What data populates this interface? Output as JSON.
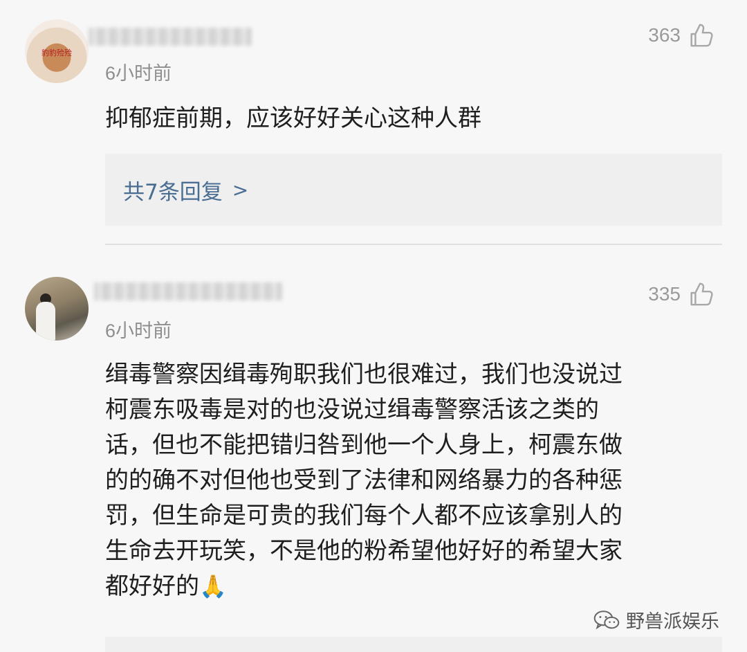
{
  "comments": [
    {
      "time": "6小时前",
      "likes": "363",
      "text_lines": [
        "抑郁症前期，应该好好关心这种人群"
      ],
      "replies_label": "共7条回复",
      "replies_arrow": ">"
    },
    {
      "time": "6小时前",
      "likes": "335",
      "text_lines": [
        "缉毒警察因缉毒殉职我们也很难过，我们也没说过",
        "柯震东吸毒是对的也没说过缉毒警察活该之类的",
        "话，但也不能把错归咎到他一个人身上，柯震东做",
        "的的确不对但他也受到了法律和网络暴力的各种惩",
        "罚，但生命是可贵的我们每个人都不应该拿别人的",
        "生命去开玩笑，不是他的粉希望他好好的希望大家",
        "都好好的"
      ],
      "emoji": "🙏"
    }
  ],
  "avatar1_caption": "豹豹殓殓",
  "watermark": "野兽派娱乐",
  "icons": {
    "like": "thumbs-up-icon",
    "watermark": "wechat-icon"
  },
  "colors": {
    "link": "#4a6e93",
    "muted": "#8e8e8e",
    "reply_bg": "#efefef"
  }
}
